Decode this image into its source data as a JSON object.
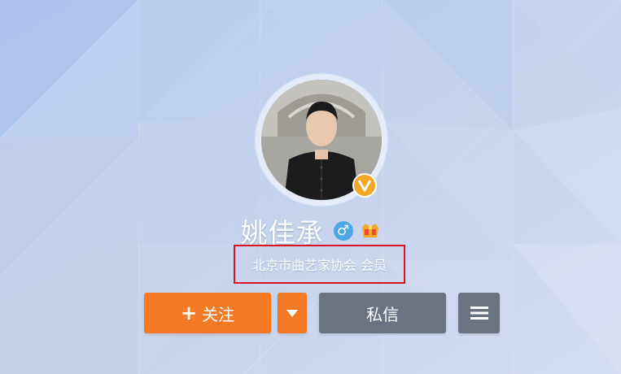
{
  "profile": {
    "name": "姚佳承",
    "description": "北京市曲艺家协会 会员",
    "gender_symbol": "♂"
  },
  "actions": {
    "follow_plus": "+",
    "follow_label": "关注",
    "message_label": "私信"
  },
  "icons": {
    "verified": "verified-v-badge",
    "gender": "male-gender-icon",
    "level": "vip-level-icon",
    "dropdown": "caret-down-icon",
    "menu": "hamburger-menu-icon"
  },
  "colors": {
    "follow_button": "#f47a25",
    "secondary_button": "#6b7280",
    "verified_badge": "#f5a623",
    "highlight_box": "#d8141c",
    "gender_icon": "#4da6e6"
  }
}
